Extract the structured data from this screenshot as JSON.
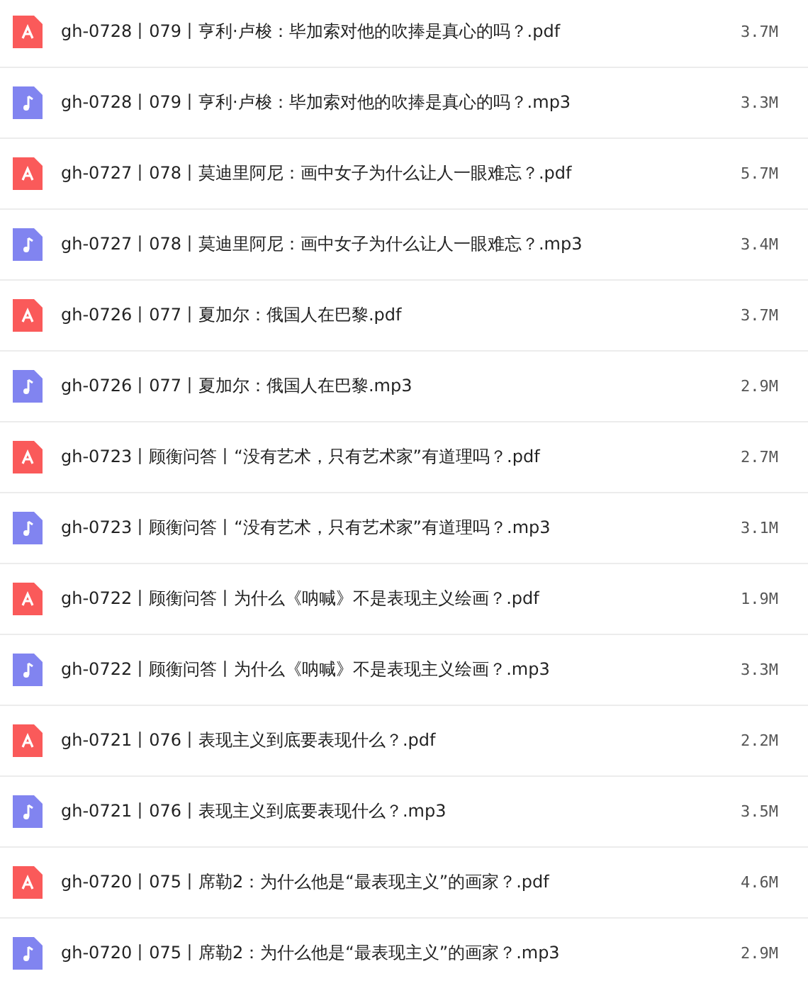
{
  "files": [
    {
      "kind": "pdf",
      "name": "gh-0728丨079丨亨利·卢梭：毕加索对他的吹捧是真心的吗？.pdf",
      "size": "3.7M"
    },
    {
      "kind": "audio",
      "name": "gh-0728丨079丨亨利·卢梭：毕加索对他的吹捧是真心的吗？.mp3",
      "size": "3.3M"
    },
    {
      "kind": "pdf",
      "name": "gh-0727丨078丨莫迪里阿尼：画中女子为什么让人一眼难忘？.pdf",
      "size": "5.7M"
    },
    {
      "kind": "audio",
      "name": "gh-0727丨078丨莫迪里阿尼：画中女子为什么让人一眼难忘？.mp3",
      "size": "3.4M"
    },
    {
      "kind": "pdf",
      "name": "gh-0726丨077丨夏加尔：俄国人在巴黎.pdf",
      "size": "3.7M"
    },
    {
      "kind": "audio",
      "name": "gh-0726丨077丨夏加尔：俄国人在巴黎.mp3",
      "size": "2.9M"
    },
    {
      "kind": "pdf",
      "name": "gh-0723丨顾衡问答丨“没有艺术，只有艺术家”有道理吗？.pdf",
      "size": "2.7M"
    },
    {
      "kind": "audio",
      "name": "gh-0723丨顾衡问答丨“没有艺术，只有艺术家”有道理吗？.mp3",
      "size": "3.1M"
    },
    {
      "kind": "pdf",
      "name": "gh-0722丨顾衡问答丨为什么《呐喊》不是表现主义绘画？.pdf",
      "size": "1.9M"
    },
    {
      "kind": "audio",
      "name": "gh-0722丨顾衡问答丨为什么《呐喊》不是表现主义绘画？.mp3",
      "size": "3.3M"
    },
    {
      "kind": "pdf",
      "name": "gh-0721丨076丨表现主义到底要表现什么？.pdf",
      "size": "2.2M"
    },
    {
      "kind": "audio",
      "name": "gh-0721丨076丨表现主义到底要表现什么？.mp3",
      "size": "3.5M"
    },
    {
      "kind": "pdf",
      "name": "gh-0720丨075丨席勒2：为什么他是“最表现主义”的画家？.pdf",
      "size": "4.6M"
    },
    {
      "kind": "audio",
      "name": "gh-0720丨075丨席勒2：为什么他是“最表现主义”的画家？.mp3",
      "size": "2.9M"
    }
  ]
}
